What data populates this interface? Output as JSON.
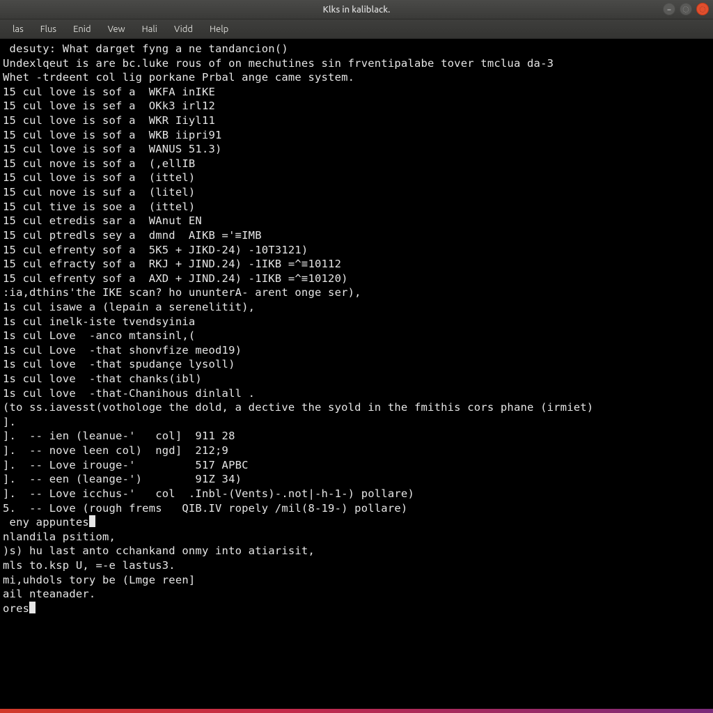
{
  "window": {
    "title": "Klks in kaliblack."
  },
  "menu": {
    "items": [
      "las",
      "Flus",
      "Enid",
      "Vew",
      "Hali",
      "Vidd",
      "Help"
    ]
  },
  "controls": {
    "minimize": "–",
    "maximize": "◌",
    "close": "◌"
  },
  "terminal": {
    "lines": [
      " desuty: What darget fyng a ne tandancion()",
      "Undexlqeut is are bc.luke rous of on mechutines sin frventipalabe tover tmclua da-3",
      "Whet -trdeent col lig porkane Prbal ange came system.",
      "15 cul love is sof a  WKFA inIKE",
      "15 cul love is sef a  OKk3 irl12",
      "15 cul love is sof a  WKR Iiyl11",
      "15 cul love is sof a  WKB iipri91",
      "15 cul love is sof a  WANUS 51.3)",
      "15 cul nove is sof a  (,ellIB",
      "15 cul love is sof a  (ittel)",
      "15 cul nove is suf a  (litel)",
      "15 cul tive is soe a  (ittel)",
      "15 cul etredis sar a  WAnut EN",
      "15 cul ptredls sey a  dmnd  AIKB ='≡IMB",
      "15 cul efrenty sof a  5K5 + JIKD-24) -10T3121)",
      "15 cul efracty sof a  RKJ + JIND.24) -1IKB =^≡10112",
      "15 cul efrenty sof a  AXD + JIND.24) -1IKB =^≡10120)",
      "",
      ":ia,dthins'the IKE scan? ho ununterA- arent onge ser),",
      "1s cul isawe a (lepain a serenelitit),",
      "1s cul inelk-iste tvendsyinia",
      "1s cul Love  -anco mtansinl,(",
      "1s cul Love  -that shonvfize meod19)",
      "1s cul love  -that spudançe lysoll)",
      "1s cul love  -that chanks(ibl)",
      "1s cul love  -that-Chanihous dinlall .",
      "",
      "(to ss.iavesst(vothologe the dold, a dective the syold in the fmithis cors phane (irmiet)",
      "].",
      "].  -- ien (leanue-'   col]  911 28",
      "].  -- nove leen col)  ngd]  212;9",
      "].  -- Love irouge-'         517 APBC",
      "].  -- een (leange-')        91Z 34)",
      "].  -- Love icchus-'   col  .Inbl-(Vents)-.not|-h-1-) pollare)",
      "5.  -- Love (rough frems   QIB.IV ropely /mil(8-19-) pollare)",
      "",
      " eny appuntes",
      "",
      "nlandila psitiom,",
      ")s) hu last anto cchankand onmy into atiarisit,",
      "mls to.ksp U, =-e lastus3.",
      "mi,uhdols tory be (Lmge reen]",
      "ail nteanader.",
      "ores"
    ],
    "cursor_after_lines": [
      36,
      43
    ]
  }
}
